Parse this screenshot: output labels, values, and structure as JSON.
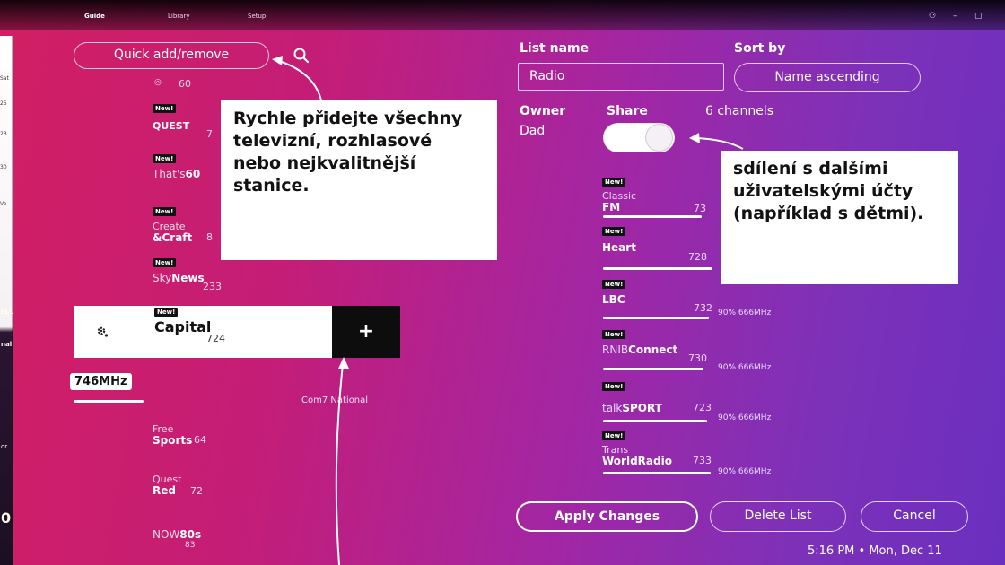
{
  "topbar": {
    "tabs": [
      "Guide",
      "Library",
      "Setup"
    ],
    "window_controls": [
      "⚇",
      "–",
      "▢"
    ]
  },
  "left_strip": {
    "fragments_top": [
      "Sat",
      "25",
      "23",
      "30",
      "Ve"
    ],
    "fragments_bottom": [
      "ELL",
      "nal",
      "or"
    ],
    "big_glyph": "0"
  },
  "channel_list": {
    "quick_add_label": "Quick add/remove",
    "new_badge": "New!",
    "items": [
      {
        "prefix": "",
        "name": "",
        "number": "60"
      },
      {
        "prefix": "",
        "name": "QUEST",
        "number": "7"
      },
      {
        "prefix": "That's",
        "name": "60",
        "number": ""
      },
      {
        "prefix": "Create",
        "name": "&Craft",
        "number": "8"
      },
      {
        "prefix": "Sky",
        "name": "News",
        "number": "233"
      }
    ],
    "selected": {
      "name": "Capital",
      "number": "724",
      "plus": "+"
    },
    "mux_tag": "746MHz",
    "mux_name": "Com7 National",
    "after": [
      {
        "prefix": "Free",
        "name": "Sports",
        "number": "64"
      },
      {
        "prefix": "Quest",
        "name": "Red",
        "number": "72"
      },
      {
        "prefix": "NOW",
        "name": "80s",
        "number": "83"
      }
    ]
  },
  "form": {
    "list_name_label": "List name",
    "list_name_value": "Radio",
    "sort_by_label": "Sort by",
    "sort_by_value": "Name ascending",
    "owner_label": "Owner",
    "owner_value": "Dad",
    "share_label": "Share",
    "channel_count": "6 channels",
    "share_on": true
  },
  "radio_list": {
    "new_badge": "New!",
    "items": [
      {
        "prefix": "Classic",
        "name": "FM",
        "number": "73",
        "mux": ""
      },
      {
        "prefix": "",
        "name": "Heart",
        "number": "728",
        "mux": ""
      },
      {
        "prefix": "",
        "name": "LBC",
        "number": "732",
        "mux": "90% 666MHz"
      },
      {
        "prefix": "RNIB",
        "name": "Connect",
        "number": "730",
        "mux": "90% 666MHz"
      },
      {
        "prefix": "talk",
        "name": "SPORT",
        "number": "723",
        "mux": "90% 666MHz"
      },
      {
        "prefix": "Trans",
        "name": "WorldRadio",
        "number": "733",
        "mux": "90% 666MHz"
      }
    ]
  },
  "buttons": {
    "apply": "Apply Changes",
    "delete": "Delete List",
    "cancel": "Cancel"
  },
  "clock": "5:16 PM • Mon, Dec 11",
  "callouts": {
    "quick_add": "Rychle přidejte všechny televizní, rozhlasové nebo nejkvalitnější stanice.",
    "share": "sdílení s dalšími uživatelskými účty (například s dětmi)."
  }
}
